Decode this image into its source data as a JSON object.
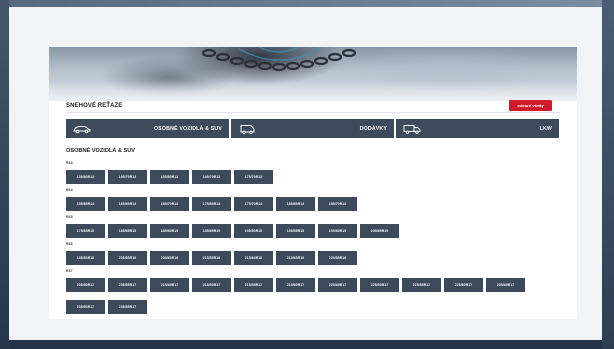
{
  "header": {
    "title": "SNEHOVÉ REŤAZE",
    "action_button": "zobraziť všetky"
  },
  "categories": [
    {
      "label": "OSOBNÉ VOZIDLÁ & SUV",
      "icon": "car-icon"
    },
    {
      "label": "DODÁVKY",
      "icon": "van-icon"
    },
    {
      "label": "LKW",
      "icon": "truck-icon"
    }
  ],
  "section": {
    "title": "OSOBNÉ VOZIDLÁ & SUV"
  },
  "groups": [
    {
      "rim": "R13",
      "sizes": [
        "135/80R13",
        "155/70R13",
        "155/80R13",
        "165/70R13",
        "175/70R13"
      ]
    },
    {
      "rim": "R14",
      "sizes": [
        "155/65R14",
        "165/65R14",
        "165/70R14",
        "175/65R14",
        "175/70R14",
        "185/65R14",
        "185/70R14"
      ]
    },
    {
      "rim": "R15",
      "sizes": [
        "175/65R15",
        "185/65R15",
        "185/60R15",
        "185/65R15",
        "195/50R15",
        "195/55R15",
        "195/60R15",
        "205/65R15"
      ]
    },
    {
      "rim": "R16",
      "sizes": [
        "195/50R16",
        "205/55R16",
        "205/60R16",
        "215/55R16",
        "215/60R16",
        "215/65R16",
        "225/55R16"
      ]
    },
    {
      "rim": "R17",
      "sizes": [
        "205/50R17",
        "205/55R17",
        "215/45R17",
        "215/50R17",
        "215/55R17",
        "215/60R17",
        "225/45R17",
        "225/50R17",
        "225/55R17",
        "225/60R17",
        "235/45R17",
        "235/50R17",
        "235/55R17"
      ]
    }
  ],
  "colors": {
    "button_bg": "#3c4a5c",
    "accent_red": "#d11a2a"
  }
}
